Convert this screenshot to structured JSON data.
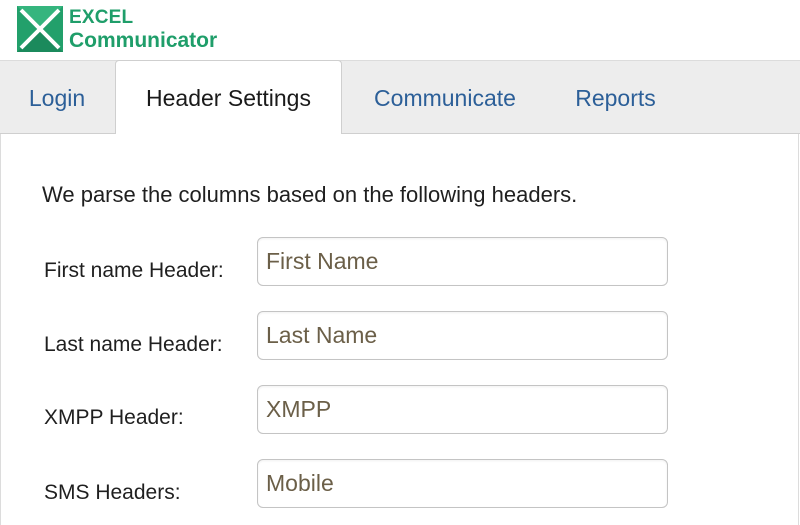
{
  "logo": {
    "icon": "excel-x-icon",
    "line1": "EXCEL",
    "line2": "Communicator",
    "brand_color": "#1f9e6a"
  },
  "tabs": [
    {
      "label": "Login",
      "active": false
    },
    {
      "label": "Header Settings",
      "active": true
    },
    {
      "label": "Communicate",
      "active": false
    },
    {
      "label": "Reports",
      "active": false
    }
  ],
  "main": {
    "intro": "We parse the columns based on the following headers.",
    "fields": [
      {
        "label": "First name Header:",
        "value": "First Name"
      },
      {
        "label": "Last name Header:",
        "value": "Last Name"
      },
      {
        "label": "XMPP Header:",
        "value": "XMPP"
      },
      {
        "label": "SMS Headers:",
        "value": "Mobile"
      }
    ]
  },
  "colors": {
    "tab_link": "#2c5f98",
    "tab_bar_bg": "#ededed",
    "input_text": "#6b5f48"
  }
}
